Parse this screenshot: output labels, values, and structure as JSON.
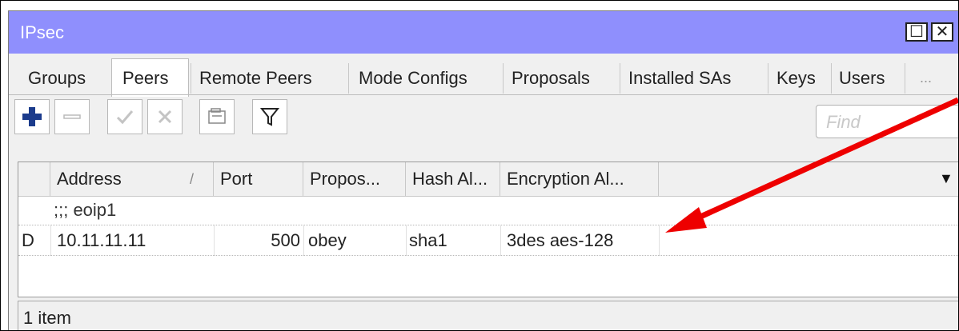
{
  "window": {
    "title": "IPsec",
    "maximize_glyph": "☐",
    "close_glyph": "✕"
  },
  "tabs": [
    {
      "label": "Groups",
      "active": false
    },
    {
      "label": "Peers",
      "active": true
    },
    {
      "label": "Remote Peers",
      "active": false
    },
    {
      "label": "Mode Configs",
      "active": false
    },
    {
      "label": "Proposals",
      "active": false
    },
    {
      "label": "Installed SAs",
      "active": false
    },
    {
      "label": "Keys",
      "active": false
    },
    {
      "label": "Users",
      "active": false
    },
    {
      "label": "...",
      "active": false
    }
  ],
  "toolbar": {
    "tools": [
      "add-icon",
      "remove-icon",
      "enable-icon",
      "disable-icon",
      "comment-icon",
      "filter-icon"
    ],
    "find_placeholder": "Find"
  },
  "table": {
    "columns": [
      "Address",
      "Port",
      "Propos...",
      "Hash Al...",
      "Encryption Al..."
    ],
    "sort_indicator": "/",
    "dropdown_glyph": "▼",
    "comment_row": ";;; eoip1",
    "rows": [
      {
        "flag": "D",
        "address": "10.11.11.11",
        "port": "500",
        "proposal": "obey",
        "hash": "sha1",
        "encryption": "3des aes-128"
      }
    ]
  },
  "status": {
    "text": "1 item"
  },
  "colors": {
    "titlebar": "#8f8ffd",
    "annotation_arrow": "#ee0000",
    "add_icon": "#1b3b8c"
  }
}
